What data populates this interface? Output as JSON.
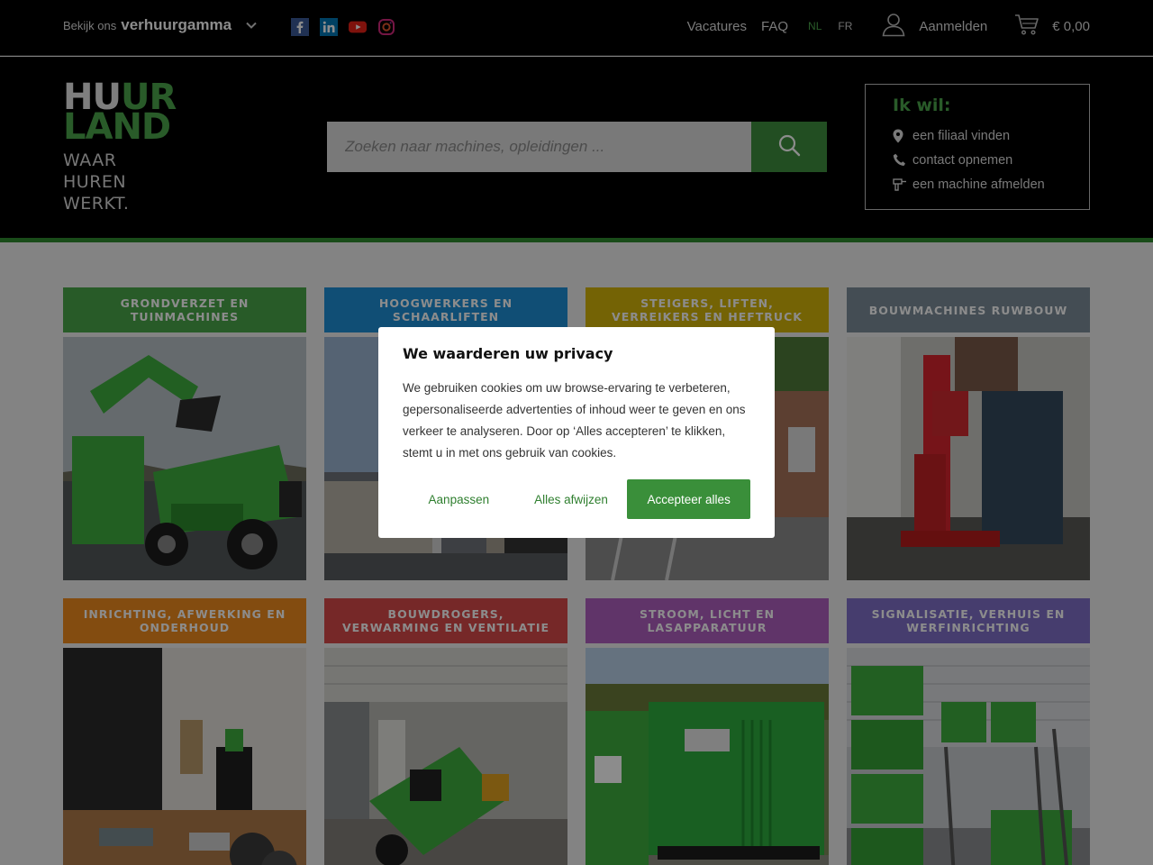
{
  "topbar": {
    "range_prefix": "Bekijk ons",
    "range_label": "verhuurgamma",
    "socials": [
      "facebook-icon",
      "linkedin-icon",
      "youtube-icon",
      "instagram-icon"
    ],
    "links": [
      "Vacatures",
      "FAQ"
    ],
    "languages": [
      {
        "code": "NL",
        "active": true
      },
      {
        "code": "FR",
        "active": false
      }
    ],
    "account_label": "Aanmelden",
    "cart_total": "€ 0,00"
  },
  "header": {
    "logo": {
      "line1_white": "HU",
      "line1_green": "UR",
      "line2": "LAND",
      "tagline": [
        "WAAR",
        "HUREN",
        "WERKT."
      ]
    },
    "search": {
      "placeholder": "Zoeken naar machines, opleidingen ..."
    },
    "ikwil": {
      "title": "Ik wil:",
      "items": [
        {
          "icon": "map-pin-icon",
          "label": "een filiaal vinden"
        },
        {
          "icon": "phone-icon",
          "label": "contact opnemen"
        },
        {
          "icon": "drill-icon",
          "label": "een machine afmelden"
        }
      ]
    }
  },
  "colors": {
    "brand_green": "#4ca64c",
    "tile_colors": [
      "#4aa64a",
      "#1e8fd6",
      "#d4b40a",
      "#7d8c99",
      "#ee8a1e",
      "#d84a4a",
      "#b060c0",
      "#8070c8"
    ]
  },
  "categories": [
    {
      "title": "GRONDVERZET EN TUINMACHINES",
      "image": "excavator-dumper-photo"
    },
    {
      "title": "HOOGWERKERS EN SCHAARLIFTEN",
      "image": "aerial-lift-photo"
    },
    {
      "title": "STEIGERS, LIFTEN, VERREIKERS EN HEFTRUCK",
      "image": "scaffolding-photo"
    },
    {
      "title": "BOUWMACHINES RUWBOUW",
      "image": "core-drill-photo"
    },
    {
      "title": "INRICHTING, AFWERKING EN ONDERHOUD",
      "image": "floor-sander-photo"
    },
    {
      "title": "BOUWDROGERS, VERWARMING EN VENTILATIE",
      "image": "dryer-photo"
    },
    {
      "title": "STROOM, LICHT EN LASAPPARATUUR",
      "image": "generator-photo"
    },
    {
      "title": "SIGNALISATIE, VERHUIS EN WERFINRICHTING",
      "image": "moving-crates-photo"
    }
  ],
  "cookie_modal": {
    "title": "We waarderen uw privacy",
    "body": "We gebruiken cookies om uw browse-ervaring te verbeteren, gepersonaliseerde advertenties of inhoud weer te geven en ons verkeer te analyseren. Door op ‘Alles accepteren’ te klikken, stemt u in met ons gebruik van cookies.",
    "buttons": {
      "customize": "Aanpassen",
      "reject": "Alles afwijzen",
      "accept": "Accepteer alles"
    }
  }
}
